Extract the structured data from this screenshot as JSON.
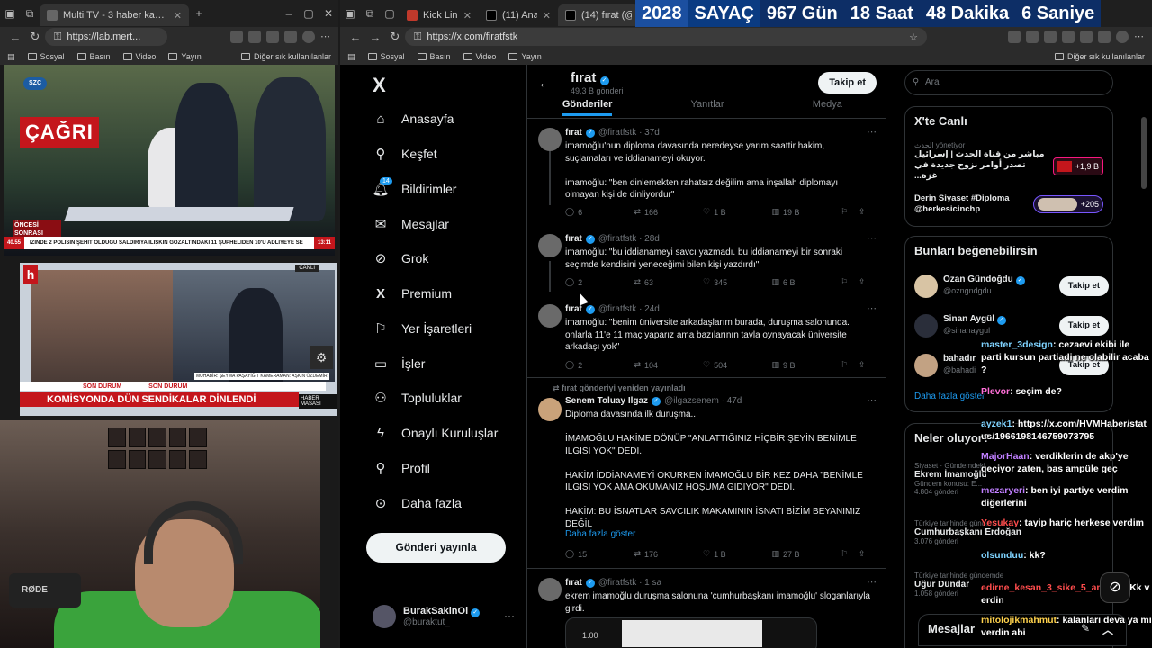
{
  "left_browser": {
    "tabs": [
      {
        "label": "Multi TV - 3 haber kanalını aynı a"
      }
    ],
    "url": "https://lab.mert...",
    "bookmarks": [
      "Sosyal",
      "Basın",
      "Video",
      "Yayın"
    ],
    "bookmarks_right": "Diğer sık kullanılanlar"
  },
  "right_browser": {
    "tabs": [
      {
        "label": "Kick Link Cra"
      },
      {
        "label": "(11) Anasayfa"
      },
      {
        "label": "(14) fırat (@fi"
      }
    ],
    "url": "https://x.com/firatfstk",
    "bookmarks": [
      "Sosyal",
      "Basın",
      "Video",
      "Yayın"
    ],
    "bookmarks_right": "Diğer sık kullanılanlar"
  },
  "countdown": {
    "year": "2028",
    "label": "SAYAÇ",
    "days": "967 Gün",
    "hours": "18 Saat",
    "minutes": "48 Dakika",
    "seconds": "6 Saniye"
  },
  "tv": {
    "szc": "SZC",
    "cagri": "ÇAĞRI",
    "oncesi": "ÖNCESİ SONRASI",
    "ticker_temp": "40.55",
    "ticker": "IZİNDE 2 POLİSİN ŞEHİT OLDUĞU SALDIRIYA İLİŞKİN GÖZALTINDAKİ 11 ŞÜPHELİDEN 10'U ADLİYEYE SE",
    "ticker_time": "13:11",
    "channel2_logo": "h",
    "channel2_live": "CANLI",
    "son_durum_1": "SON DURUM",
    "son_durum_2": "SON DURUM",
    "names": "MUHABİR: ŞEYMA PAŞAYİĞİT  KAMERAMAN: AŞKIN ÖZDEMİR",
    "headline": "KOMİSYONDA DÜN SENDİKALAR DİNLENDİ",
    "haber_masasi": "HABER MASASI"
  },
  "webcam": {
    "mic": "RØDE"
  },
  "x_nav": {
    "logo": "X",
    "items": [
      {
        "label": "Anasayfa",
        "icon": "home-icon"
      },
      {
        "label": "Keşfet",
        "icon": "search-icon"
      },
      {
        "label": "Bildirimler",
        "icon": "bell-icon",
        "badge": "14"
      },
      {
        "label": "Mesajlar",
        "icon": "mail-icon"
      },
      {
        "label": "Grok",
        "icon": "grok-icon"
      },
      {
        "label": "Premium",
        "icon": "x-premium-icon"
      },
      {
        "label": "Yer İşaretleri",
        "icon": "bookmark-icon"
      },
      {
        "label": "İşler",
        "icon": "briefcase-icon"
      },
      {
        "label": "Topluluklar",
        "icon": "people-icon"
      },
      {
        "label": "Onaylı Kuruluşlar",
        "icon": "lightning-icon"
      },
      {
        "label": "Profil",
        "icon": "person-icon"
      },
      {
        "label": "Daha fazla",
        "icon": "more-circle-icon"
      }
    ],
    "post_button": "Gönderi yayınla",
    "account": {
      "name": "BurakSakinOl",
      "handle": "@buraktut_"
    }
  },
  "profile": {
    "name": "fırat",
    "post_count": "49,3 B gönderi",
    "follow_button": "Takip et",
    "tabs": [
      "Gönderiler",
      "Yanıtlar",
      "Medya"
    ]
  },
  "tweets": [
    {
      "name": "fırat",
      "handle": "@firatfstk · 37d",
      "text": "imamoğlu'nun diploma davasında neredeyse yarım saattir hakim, suçlamaları ve iddianameyi okuyor.\n\nimamoğlu: \"ben dinlemekten rahatsız değilim ama inşallah diplomayı olmayan kişi de dinliyordur\"",
      "replies": "6",
      "reposts": "166",
      "likes": "1 B",
      "views": "19 B"
    },
    {
      "name": "fırat",
      "handle": "@firatfstk · 28d",
      "text": "imamoğlu: \"bu iddianameyi savcı yazmadı. bu iddianameyi bir sonraki seçimde kendisini yeneceğimi bilen kişi yazdırdı\"",
      "replies": "2",
      "reposts": "63",
      "likes": "345",
      "views": "6 B"
    },
    {
      "name": "fırat",
      "handle": "@firatfstk · 24d",
      "text": "imamoğlu: \"benim üniversite arkadaşlarım burada, duruşma salonunda. onlarla 11'e 11 maç yaparız ama bazılarının tavla oynayacak üniversite arkadaşı yok\"",
      "replies": "2",
      "reposts": "104",
      "likes": "504",
      "views": "9 B"
    },
    {
      "repost_line": "fırat gönderiyi yeniden yayınladı",
      "name": "Senem Toluay Ilgaz",
      "handle": "@ilgazsenem · 47d",
      "text": "Diploma davasında ilk duruşma...\n\nİMAMOĞLU HAKİME DÖNÜP \"ANLATTIĞINIZ HİÇBİR ŞEYİN BENİMLE İLGİSİ YOK\" DEDİ.\n\nHAKİM İDDİANAMEYİ OKURKEN İMAMOĞLU BİR KEZ DAHA \"BENİMLE İLGİSİ YOK AMA OKUMANIZ HOŞUMA GİDİYOR\" DEDİ.\n\nHAKİM: BU İSNATLAR SAVCILIK MAKAMININ İSNATI BİZİM BEYANIMIZ DEĞİL",
      "show_more": "Daha fazla göster",
      "replies": "15",
      "reposts": "176",
      "likes": "1 B",
      "views": "27 B"
    },
    {
      "name": "fırat",
      "handle": "@firatfstk · 1 sa",
      "text": "ekrem imamoğlu duruşma salonuna 'cumhurbaşkanı imamoğlu' sloganlarıyla girdi.",
      "media_label": "1.00"
    }
  ],
  "right_col": {
    "search_placeholder": "Ara",
    "live_title": "X'te Canlı",
    "live_host": "الحدث  yönetiyor",
    "live_item1": "مباشر من قناة الحدث | إسرائيل تصدر أوامر نزوح جديدة في غزة...",
    "live_pill1": "+1,9 B",
    "live_item2": "Derin Siyaset #Diploma @herkesicinchp",
    "live_pill2": "+205",
    "suggest_title": "Bunları beğenebilirsin",
    "suggestions": [
      {
        "name": "Ozan Gündoğdu",
        "handle": "@ozngndgdu",
        "button": "Takip et"
      },
      {
        "name": "Sinan Aygül",
        "handle": "@sinanaygul",
        "button": "Takip et"
      },
      {
        "name": "bahadır",
        "handle": "@bahadi",
        "button": "Takip et"
      }
    ],
    "more": "Daha fazla göster",
    "trends_title": "Neler oluyor?",
    "trends": [
      {
        "cat": "Siyaset · Gündemdeki",
        "topic": "Ekrem İmamoğlu",
        "posts": "Gündem konusu: E..."
      },
      {
        "cat": "",
        "topic": "",
        "posts": "4.804 gönderi"
      },
      {
        "cat": "Türkiye tarihinde gündemde",
        "topic": "Cumhurbaşkanı Erdoğan",
        "posts": "3.076 gönderi"
      },
      {
        "cat": "Türkiye tarihinde gündemde",
        "topic": "Uğur Dündar",
        "posts": "1.058 gönderi"
      }
    ],
    "dm_label": "Mesajlar"
  },
  "chat": [
    {
      "user": "master_3design",
      "color": "#7fd3ff",
      "text": "cezaevi ekibi ile parti kursun partiadi ne olabilir acaba ?"
    },
    {
      "user": "Plevor",
      "color": "#ff6fd8",
      "text": "seçim de?"
    },
    {
      "user": "ayzek1",
      "color": "#7fd3ff",
      "text": "https://x.com/HVMHaber/status/1966198146759073795"
    },
    {
      "user": "MajorHaan",
      "color": "#c07fff",
      "text": "verdiklerin de akp'ye geçiyor zaten, bas ampüle geç"
    },
    {
      "user": "mezaryeri",
      "color": "#c07fff",
      "text": "ben iyi partiye verdim diğerlerini"
    },
    {
      "user": "Yesukay",
      "color": "#ff4d4d",
      "text": "tayip hariç herkese verdim"
    },
    {
      "user": "olsunduu",
      "color": "#7fd3ff",
      "text": "kk?"
    },
    {
      "user": "edirne_kesan_3_sike_5_am",
      "color": "#ff4d4d",
      "text": "sen Kk verdin"
    },
    {
      "user": "mitolojikmahmut",
      "color": "#ffd24d",
      "text": "kalanları deva ya mı verdin abi"
    }
  ]
}
